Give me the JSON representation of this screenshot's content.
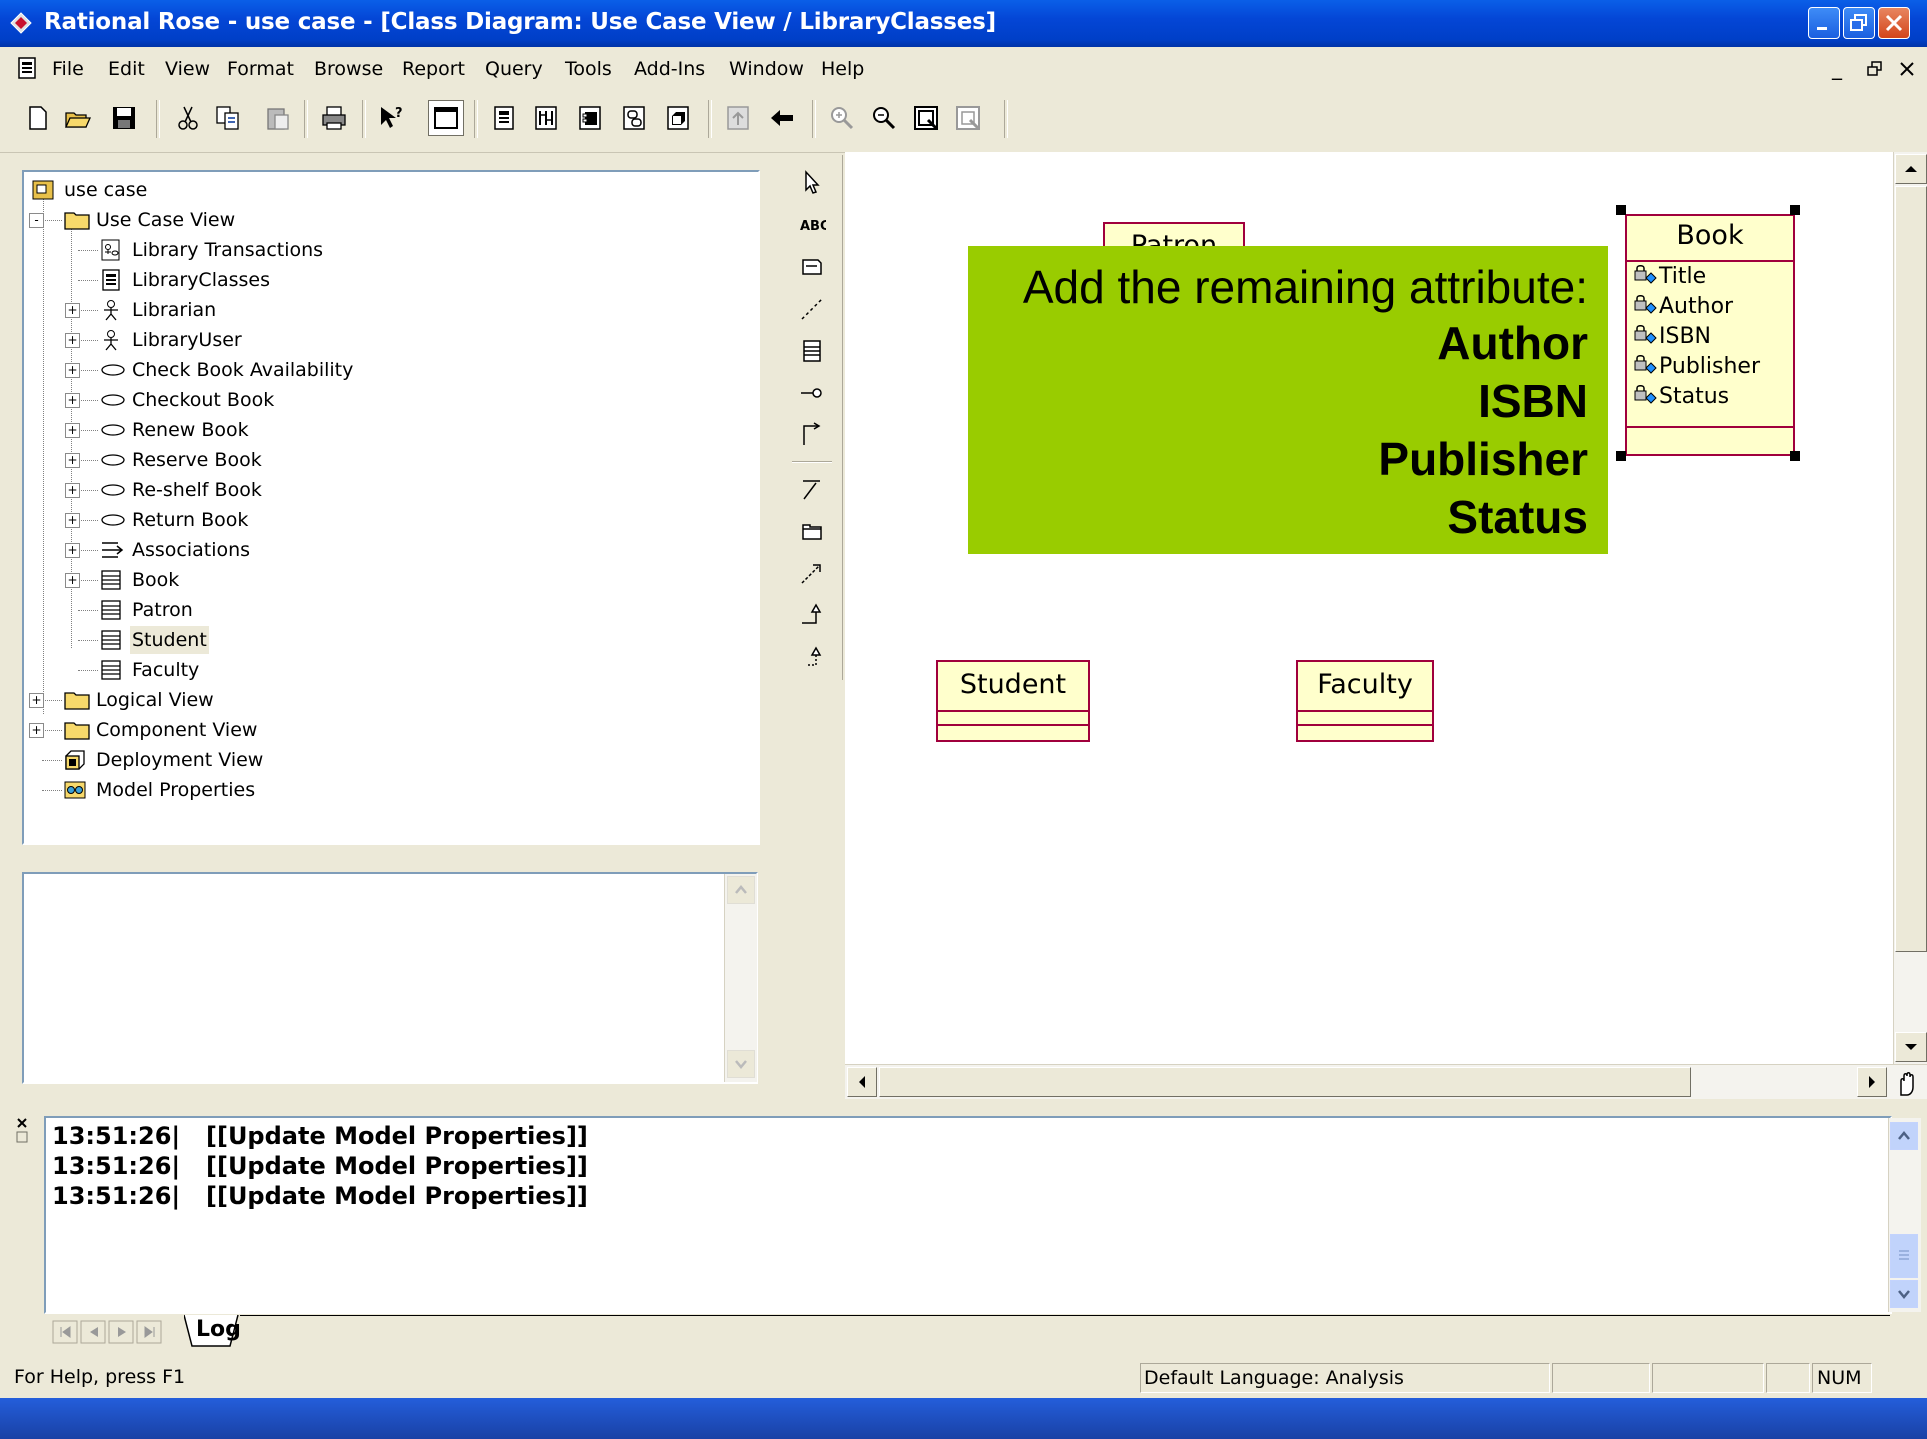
{
  "window": {
    "title": "Rational Rose - use case - [Class Diagram: Use Case View / LibraryClasses]"
  },
  "menu": [
    "File",
    "Edit",
    "View",
    "Format",
    "Browse",
    "Report",
    "Query",
    "Tools",
    "Add-Ins",
    "Window",
    "Help"
  ],
  "browser_tree": [
    {
      "label": "use case",
      "icon": "model-icon",
      "level": 0,
      "expand": ""
    },
    {
      "label": "Use Case View",
      "icon": "folder-icon",
      "level": 1,
      "expand": "-"
    },
    {
      "label": "Library Transactions",
      "icon": "use-case-diagram-icon",
      "level": 2,
      "expand": ""
    },
    {
      "label": "LibraryClasses",
      "icon": "class-diagram-icon",
      "level": 2,
      "expand": ""
    },
    {
      "label": "Librarian",
      "icon": "actor-icon",
      "level": 2,
      "expand": "+"
    },
    {
      "label": "LibraryUser",
      "icon": "actor-icon",
      "level": 2,
      "expand": "+"
    },
    {
      "label": "Check Book Availability",
      "icon": "use-case-icon",
      "level": 2,
      "expand": "+"
    },
    {
      "label": "Checkout Book",
      "icon": "use-case-icon",
      "level": 2,
      "expand": "+"
    },
    {
      "label": "Renew Book",
      "icon": "use-case-icon",
      "level": 2,
      "expand": "+"
    },
    {
      "label": "Reserve Book",
      "icon": "use-case-icon",
      "level": 2,
      "expand": "+"
    },
    {
      "label": "Re-shelf Book",
      "icon": "use-case-icon",
      "level": 2,
      "expand": "+"
    },
    {
      "label": "Return Book",
      "icon": "use-case-icon",
      "level": 2,
      "expand": "+"
    },
    {
      "label": "Associations",
      "icon": "associations-icon",
      "level": 2,
      "expand": "+"
    },
    {
      "label": "Book",
      "icon": "class-icon",
      "level": 2,
      "expand": "+"
    },
    {
      "label": "Patron",
      "icon": "class-icon",
      "level": 2,
      "expand": ""
    },
    {
      "label": "Student",
      "icon": "class-icon",
      "level": 2,
      "expand": "",
      "selected": true
    },
    {
      "label": "Faculty",
      "icon": "class-icon",
      "level": 2,
      "expand": ""
    },
    {
      "label": "Logical View",
      "icon": "folder-icon",
      "level": 1,
      "expand": "+"
    },
    {
      "label": "Component View",
      "icon": "folder-icon",
      "level": 1,
      "expand": "+"
    },
    {
      "label": "Deployment View",
      "icon": "deployment-icon",
      "level": 1,
      "expand": ""
    },
    {
      "label": "Model Properties",
      "icon": "model-properties-icon",
      "level": 1,
      "expand": ""
    }
  ],
  "diagram": {
    "classes": {
      "patron": {
        "name": "Patron"
      },
      "book": {
        "name": "Book",
        "attributes": [
          "Title",
          "Author",
          "ISBN",
          "Publisher",
          "Status"
        ]
      },
      "student": {
        "name": "Student"
      },
      "faculty": {
        "name": "Faculty"
      }
    }
  },
  "callout": {
    "line1": "Add the remaining attribute:",
    "items": [
      "Author",
      "ISBN",
      "Publisher",
      "Status"
    ]
  },
  "log": [
    {
      "time": "13:51:26|",
      "message": "[[Update Model Properties]]"
    },
    {
      "time": "13:51:26|",
      "message": "[[Update Model Properties]]"
    },
    {
      "time": "13:51:26|",
      "message": "[[Update Model Properties]]"
    }
  ],
  "log_tab": "Log",
  "status": {
    "help": "For Help, press F1",
    "language": "Default Language: Analysis",
    "num": "NUM"
  },
  "colors": {
    "callout_bg": "#99cc00",
    "class_fill": "#ffffcc",
    "class_border": "#a0003c"
  }
}
